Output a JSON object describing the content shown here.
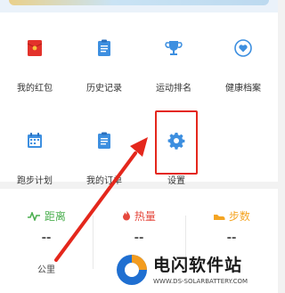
{
  "menu": {
    "items": [
      {
        "label": "我的红包",
        "icon": "red-envelope-icon"
      },
      {
        "label": "历史记录",
        "icon": "clipboard-icon"
      },
      {
        "label": "运动排名",
        "icon": "trophy-icon"
      },
      {
        "label": "健康档案",
        "icon": "heart-icon"
      },
      {
        "label": "跑步计划",
        "icon": "calendar-icon"
      },
      {
        "label": "我的订单",
        "icon": "clipboard-icon"
      },
      {
        "label": "设置",
        "icon": "gear-icon"
      }
    ]
  },
  "stats": [
    {
      "label": "距离",
      "value": "--",
      "unit": "公里",
      "color": "#4caf50",
      "icon": "pulse-icon"
    },
    {
      "label": "热量",
      "value": "--",
      "unit": "",
      "color": "#e5483d",
      "icon": "flame-icon"
    },
    {
      "label": "步数",
      "value": "--",
      "unit": "",
      "color": "#f4a524",
      "icon": "shoe-icon"
    }
  ],
  "watermark": {
    "title": "电闪软件站",
    "url": "WWW.DS-SOLARBATTERY.COM"
  },
  "colors": {
    "accent": "#3d8fe0",
    "highlight": "#e4271c"
  }
}
